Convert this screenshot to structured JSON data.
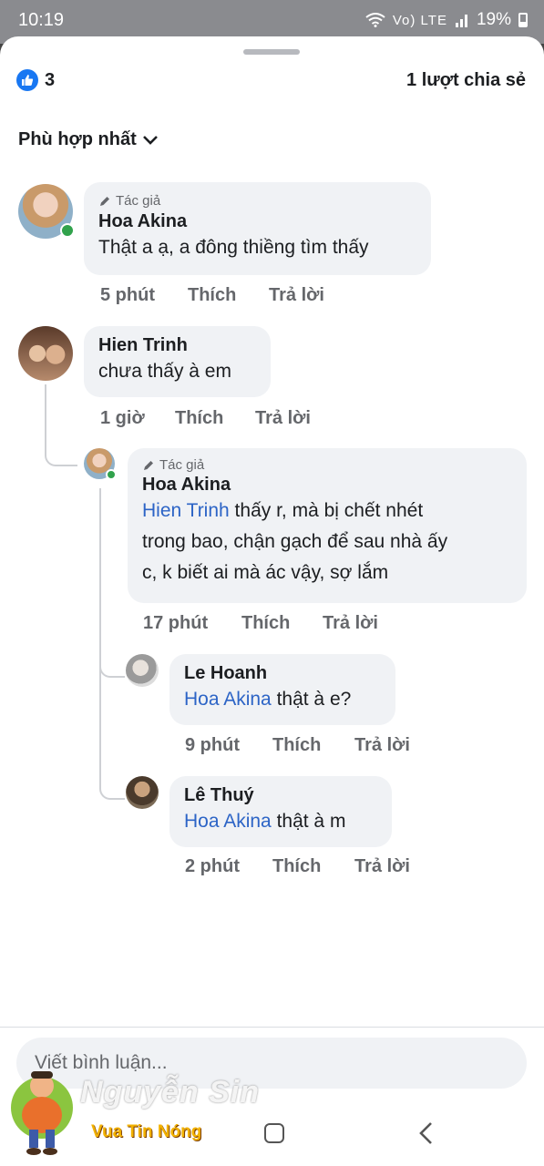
{
  "status_bar": {
    "time": "10:19",
    "network_icons": "Vo) LTE",
    "battery": "19%"
  },
  "post": {
    "like_count": "3",
    "shares": "1 lượt chia sẻ"
  },
  "sort": {
    "label": "Phù hợp nhất"
  },
  "comments": [
    {
      "author_tag": "Tác giả",
      "name": "Hoa Akina",
      "text": "Thật a ạ, a đông thiềng tìm thấy",
      "time": "5 phút",
      "like": "Thích",
      "reply": "Trả lời"
    },
    {
      "name": "Hien Trinh",
      "text": "chưa thấy à em",
      "time": "1 giờ",
      "like": "Thích",
      "reply": "Trả lời",
      "replies": [
        {
          "author_tag": "Tác giả",
          "name": "Hoa Akina",
          "mention": "Hien Trinh",
          "text_line1": " thấy r, mà bị chết nhét",
          "text_line2": "trong bao, chận gạch để sau nhà ấy",
          "text_line3": "c, k biết ai mà ác vậy, sợ lắm",
          "time": "17 phút",
          "like": "Thích",
          "reply": "Trả lời"
        },
        {
          "name": "Le Hoanh",
          "mention": "Hoa Akina",
          "text": " thật à e?",
          "time": "9 phút",
          "like": "Thích",
          "reply": "Trả lời"
        },
        {
          "name": "Lê Thuý",
          "mention": "Hoa Akina",
          "text": " thật à m",
          "time": "2 phút",
          "like": "Thích",
          "reply": "Trả lời"
        }
      ]
    }
  ],
  "composer": {
    "placeholder": "Viết bình luận..."
  },
  "watermark": {
    "name": "Nguyễn Sin",
    "subtitle": "Vua Tin Nóng"
  },
  "icons": [
    "like-icon",
    "chevron-down-icon",
    "pencil-icon",
    "online-dot-icon",
    "home-icon",
    "back-icon",
    "wifi-icon",
    "signal-icon",
    "battery-icon"
  ],
  "colors": {
    "link": "#2c64c6",
    "like_blue": "#1877f2",
    "bubble": "#f0f2f5",
    "online": "#31a24c"
  }
}
